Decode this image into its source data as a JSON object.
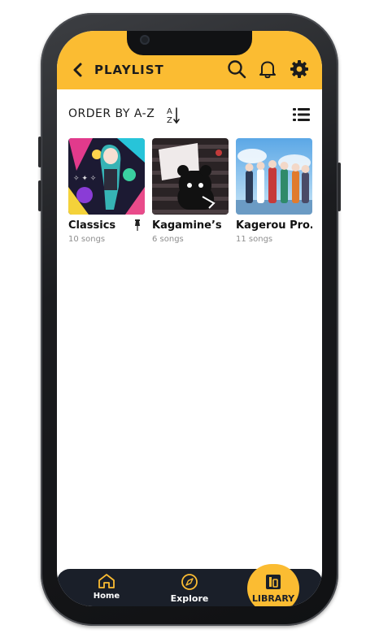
{
  "header": {
    "title": "PLAYLIST",
    "icons": [
      "back-chevron-icon",
      "search-icon",
      "bell-icon",
      "gear-icon"
    ],
    "background_color": "#fbbc32"
  },
  "sort_bar": {
    "label": "ORDER BY A-Z",
    "sort_icon": "sort-az-icon",
    "view_icon": "list-view-icon"
  },
  "playlists": [
    {
      "title": "Classics",
      "subtitle": "10 songs",
      "pinned": true
    },
    {
      "title": "Kagamine’s",
      "subtitle": "6 songs",
      "pinned": false
    },
    {
      "title": "Kagerou Pro…",
      "subtitle": "11 songs",
      "pinned": false
    }
  ],
  "bottom_nav": {
    "items": [
      {
        "label": "Home",
        "icon": "home-icon",
        "active": false
      },
      {
        "label": "Explore",
        "icon": "compass-icon",
        "active": false
      },
      {
        "label": "LIBRARY",
        "icon": "library-icon",
        "active": true
      }
    ],
    "background_color": "#1a1f29",
    "active_color": "#fbbc32"
  }
}
